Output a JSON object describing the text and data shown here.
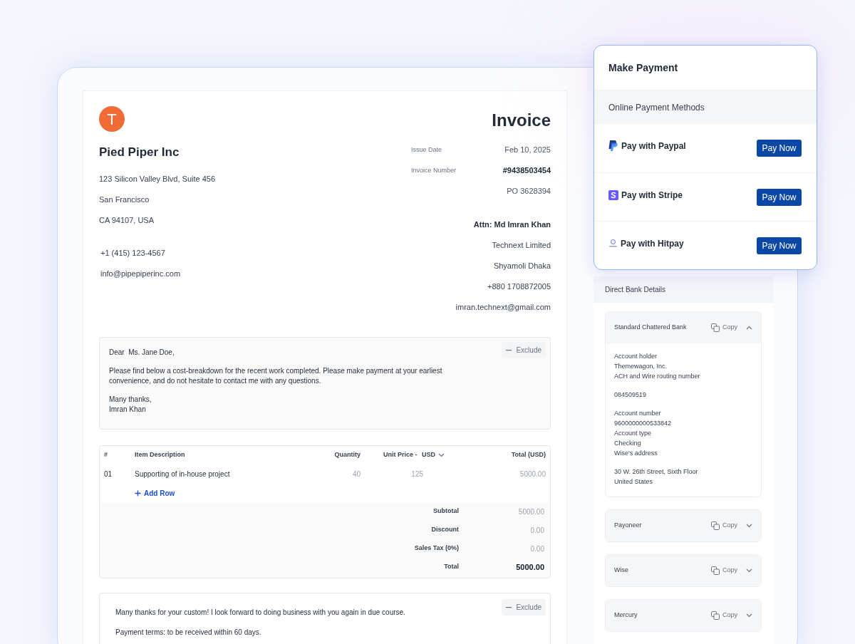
{
  "invoice": {
    "logo_letter": "T",
    "title": "Invoice",
    "company": "Pied Piper Inc",
    "address_lines": [
      "123 Silicon Valley Blvd, Suite 456",
      "San Francisco",
      "CA 94107, USA"
    ],
    "contact_lines": [
      "+1 (415) 123-4567",
      "info@pipepiperinc.com"
    ],
    "meta": [
      {
        "label": "Issue Date",
        "value": "Feb 10, 2025",
        "kind": "plain"
      },
      {
        "label": "Invoice Number",
        "value": "#9438503454",
        "kind": "strong"
      },
      {
        "value": "PO 3628394",
        "kind": "plain"
      }
    ],
    "bill_to": {
      "attention": "Attn: Md Imran Khan",
      "lines": [
        "Technext Limited",
        "Shyamoli Dhaka",
        "+880 1708872005",
        "imran.technext@gmail.com"
      ]
    }
  },
  "letter": {
    "exclude_button": "Exclude",
    "paragraphs": [
      [
        "Dear  Ms. Jane Doe,"
      ],
      [
        "Please find below a cost-breakdown for the recent work completed. Please make payment at your earliest convenience, and do not hesitate to contact me with any questions."
      ],
      [
        "Many thanks,",
        "Imran Khan"
      ]
    ]
  },
  "items_table": {
    "columns": [
      "#",
      "Item Description",
      "Quantity",
      "Unit Price - ",
      "Total (USD)"
    ],
    "currency_select": "USD",
    "rows": [
      [
        "01",
        "Supporting of in-house project",
        "40",
        "125",
        "5000.00"
      ]
    ],
    "add_row": "Add Row",
    "summary": [
      {
        "label": "Subtotal",
        "value": "5000.00",
        "kind": "line"
      },
      {
        "label": "Discount",
        "value": "0.00",
        "kind": "line"
      },
      {
        "label": "Sales Tax (0%)",
        "value": "0.00",
        "kind": "line"
      },
      {
        "label": "Total",
        "value": "5000.00",
        "kind": "total"
      }
    ]
  },
  "closing_note": {
    "exclude_button": "Exclude",
    "paragraphs": [
      "Many thanks for your custom! I look forward to doing business with you again in due course.",
      "Payment terms: to be received within 60 days."
    ]
  },
  "make_payment": {
    "title": "Make Payment",
    "section": "Online Payment Methods",
    "methods": [
      {
        "name": "Pay with Paypal",
        "kind": "paypal",
        "button": "Pay Now"
      },
      {
        "name": "Pay with Stripe",
        "kind": "stripe",
        "button": "Pay Now"
      },
      {
        "name": "Pay with Hitpay",
        "kind": "hitpay",
        "button": "Pay Now"
      }
    ]
  },
  "bank_details": {
    "title": "Direct Bank Details",
    "accounts": [
      {
        "name": "Standard Chattered Bank",
        "copy": "Copy",
        "expanded": true,
        "details": [
          [
            "Account holder",
            "Themewagon, Inc.",
            "ACH and Wire routing number"
          ],
          [
            "084509519"
          ],
          [
            "Account number",
            "9600000000533842",
            "Account type",
            "Checking",
            "Wise's address"
          ],
          [
            "30 W. 26th Street, Sixth Floor",
            "United States"
          ]
        ]
      },
      {
        "name": "Payoneer",
        "copy": "Copy",
        "expanded": false
      },
      {
        "name": "Wise",
        "copy": "Copy",
        "expanded": false
      },
      {
        "name": "Mercury",
        "copy": "Copy",
        "expanded": false
      }
    ]
  }
}
